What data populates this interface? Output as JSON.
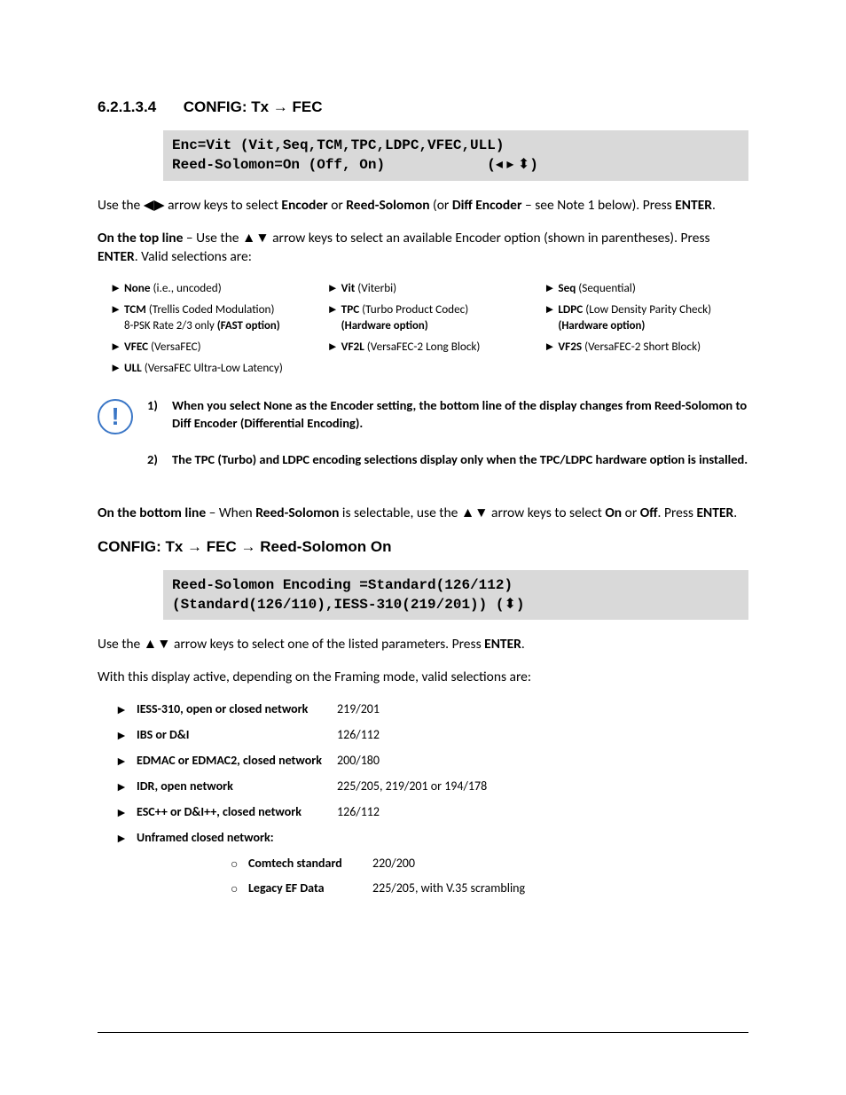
{
  "section": {
    "number": "6.2.1.3.4",
    "title_prefix": "CONFIG: Tx ",
    "title_arrow": "→",
    "title_suffix": " FEC"
  },
  "code1": {
    "line1": "Enc=Vit (Vit,Seq,TCM,TPC,LDPC,VFEC,ULL)",
    "line2_left": "Reed-Solomon=On (Off, On)",
    "line2_nav_open": "(",
    "line2_nav_syms": "◂ ▸ ⬍",
    "line2_nav_close": ")"
  },
  "para1": {
    "pre": "Use the ",
    "arrows": "◀▶",
    "mid": " arrow keys to select ",
    "b1": "Encoder",
    "or": " or ",
    "b2": "Reed-Solomon",
    "paren_pre": " (or ",
    "b3": "Diff Encoder",
    "paren_post": " – see Note 1 below). Press ",
    "b4": "ENTER",
    "end": "."
  },
  "para2": {
    "b1": "On the top line",
    "mid1": " – Use the ",
    "arrows": "▲▼",
    "mid2": " arrow keys to select an available Encoder option (shown in parentheses). Press ",
    "b2": "ENTER",
    "end": ". Valid selections are:"
  },
  "encoders": {
    "col1": [
      {
        "term": "None",
        "desc": " (i.e., uncoded)",
        "note": ""
      },
      {
        "term": "TCM",
        "desc": " (Trellis Coded Modulation)",
        "note": "8-PSK Rate 2/3 only ",
        "note_b": "(FAST option)"
      },
      {
        "term": "VFEC",
        "desc": " (VersaFEC)",
        "note": ""
      },
      {
        "term": "ULL",
        "desc": " (VersaFEC Ultra-Low Latency)",
        "note": ""
      }
    ],
    "col2": [
      {
        "term": "Vit",
        "desc": " (Viterbi)",
        "note": ""
      },
      {
        "term": "TPC",
        "desc": " (Turbo Product Codec)",
        "note": "",
        "note_b": "(Hardware option)"
      },
      {
        "term": "VF2L",
        "desc": " (VersaFEC-2 Long Block)",
        "note": ""
      }
    ],
    "col3": [
      {
        "term": "Seq",
        "desc": " (Sequential)",
        "note": ""
      },
      {
        "term": "LDPC",
        "desc": " (Low Density Parity Check) ",
        "note": "",
        "note_b": "(Hardware option)"
      },
      {
        "term": "VF2S",
        "desc": " (VersaFEC-2 Short Block)",
        "note": ""
      }
    ]
  },
  "notes": [
    {
      "num": "1)",
      "text": "When you select None as the Encoder setting, the bottom line of the display changes from Reed-Solomon to Diff Encoder (Differential Encoding)."
    },
    {
      "num": "2)",
      "text": "The TPC (Turbo) and LDPC encoding selections display only when the TPC/LDPC hardware option is installed."
    }
  ],
  "para3": {
    "b1": "On the bottom line",
    "mid1": " – When ",
    "b2": "Reed-Solomon",
    "mid2": " is selectable, use the ",
    "arrows": "▲▼",
    "mid3": " arrow keys to select ",
    "b3": "On",
    "or": " or ",
    "b4": "Off",
    "mid4": ". Press ",
    "b5": "ENTER",
    "end": "."
  },
  "sub_heading": "CONFIG: Tx → FEC → Reed-Solomon On",
  "code2": {
    "line1": "Reed-Solomon Encoding =Standard(126/112)",
    "line2_left": "(Standard(126/110),IESS-310(219/201))",
    "line2_sp": "  ",
    "line2_nav_open": "(",
    "line2_nav_syms": "⬍",
    "line2_nav_close": ")"
  },
  "para4": {
    "pre": "Use the ",
    "arrows": "▲▼",
    "mid": " arrow keys to select one of the listed parameters. Press ",
    "b": "ENTER",
    "end": "."
  },
  "para5": "With this display active, depending on the Framing mode, valid selections are:",
  "rs_rows": [
    {
      "term": "IESS-310, open or closed network",
      "val": "219/201"
    },
    {
      "term": "IBS or D&I",
      "val": "126/112"
    },
    {
      "term": "EDMAC or EDMAC2, closed network",
      "val": "200/180"
    },
    {
      "term": "IDR, open network",
      "val": "225/205,  219/201 or  194/178"
    },
    {
      "term": "ESC++ or D&I++, closed network",
      "val": "126/112"
    },
    {
      "term": "Unframed closed network:",
      "val": ""
    }
  ],
  "rs_sub": [
    {
      "term": "Comtech standard",
      "val": "220/200"
    },
    {
      "term": "Legacy EF Data",
      "val": "225/205, with V.35 scrambling"
    }
  ],
  "bullet_solid": "►",
  "bullet_hollow": "○"
}
